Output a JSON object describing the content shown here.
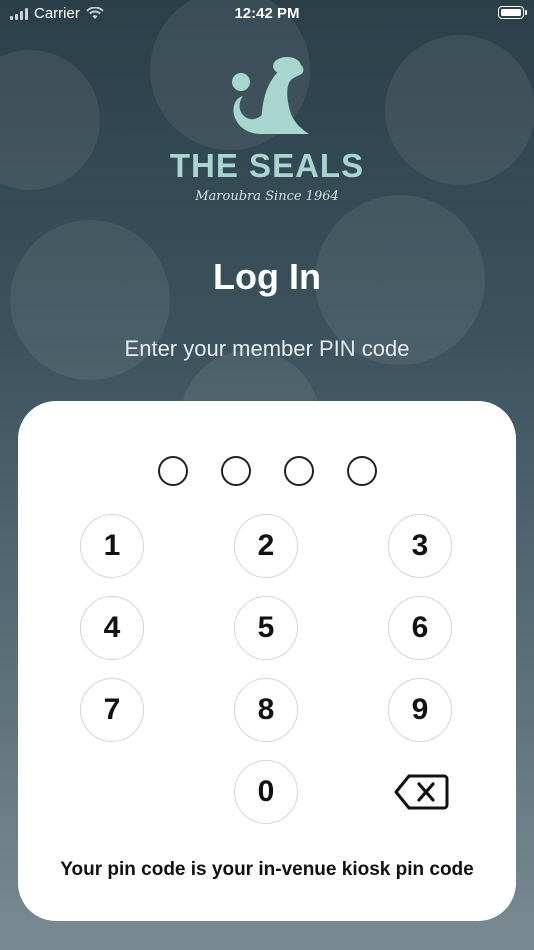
{
  "status_bar": {
    "carrier": "Carrier",
    "time": "12:42 PM"
  },
  "logo": {
    "name": "THE SEALS",
    "tagline": "Maroubra Since 1964"
  },
  "title": "Log In",
  "subtitle": "Enter your member PIN code",
  "keypad": {
    "keys": [
      "1",
      "2",
      "3",
      "4",
      "5",
      "6",
      "7",
      "8",
      "9",
      "0"
    ],
    "backspace_icon": "backspace-icon"
  },
  "pin": {
    "length": 4,
    "entered": 0
  },
  "footer_note": "Your pin code is your in-venue kiosk pin code",
  "colors": {
    "brand": "#a7d6cf",
    "background_top": "#2b3f49",
    "card": "#ffffff"
  }
}
